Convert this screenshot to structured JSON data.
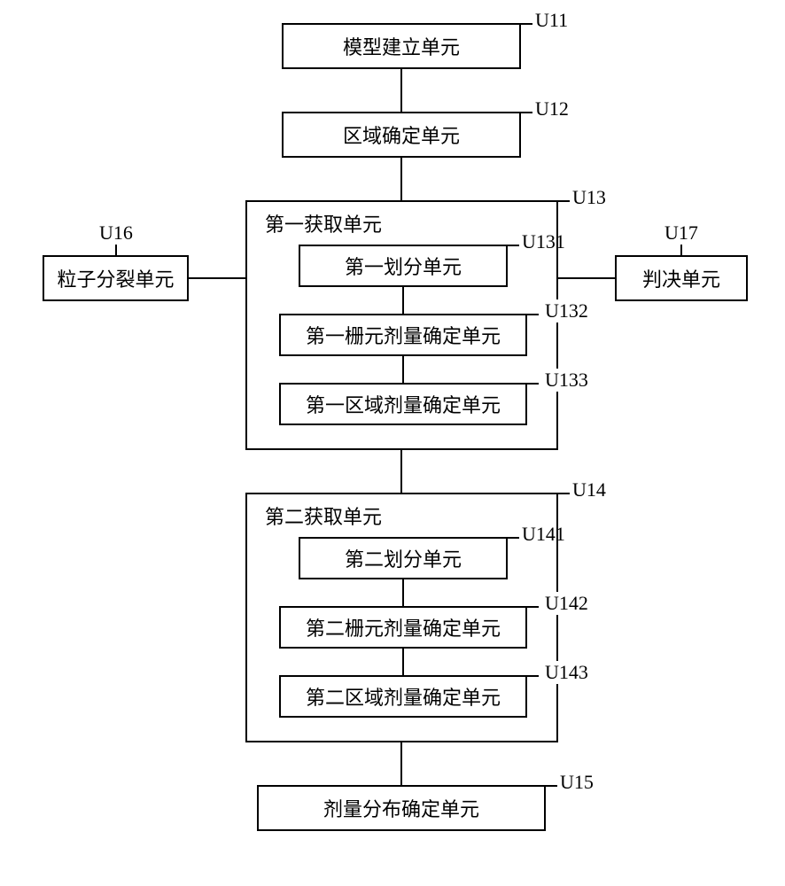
{
  "boxes": {
    "u11": {
      "label": "模型建立单元",
      "tag": "U11"
    },
    "u12": {
      "label": "区域确定单元",
      "tag": "U12"
    },
    "u13": {
      "title": "第一获取单元",
      "tag": "U13",
      "children": {
        "u131": {
          "label": "第一划分单元",
          "tag": "U131"
        },
        "u132": {
          "label": "第一栅元剂量确定单元",
          "tag": "U132"
        },
        "u133": {
          "label": "第一区域剂量确定单元",
          "tag": "U133"
        }
      }
    },
    "u14": {
      "title": "第二获取单元",
      "tag": "U14",
      "children": {
        "u141": {
          "label": "第二划分单元",
          "tag": "U141"
        },
        "u142": {
          "label": "第二栅元剂量确定单元",
          "tag": "U142"
        },
        "u143": {
          "label": "第二区域剂量确定单元",
          "tag": "U143"
        }
      }
    },
    "u15": {
      "label": "剂量分布确定单元",
      "tag": "U15"
    },
    "u16": {
      "label": "粒子分裂单元",
      "tag": "U16"
    },
    "u17": {
      "label": "判决单元",
      "tag": "U17"
    }
  }
}
